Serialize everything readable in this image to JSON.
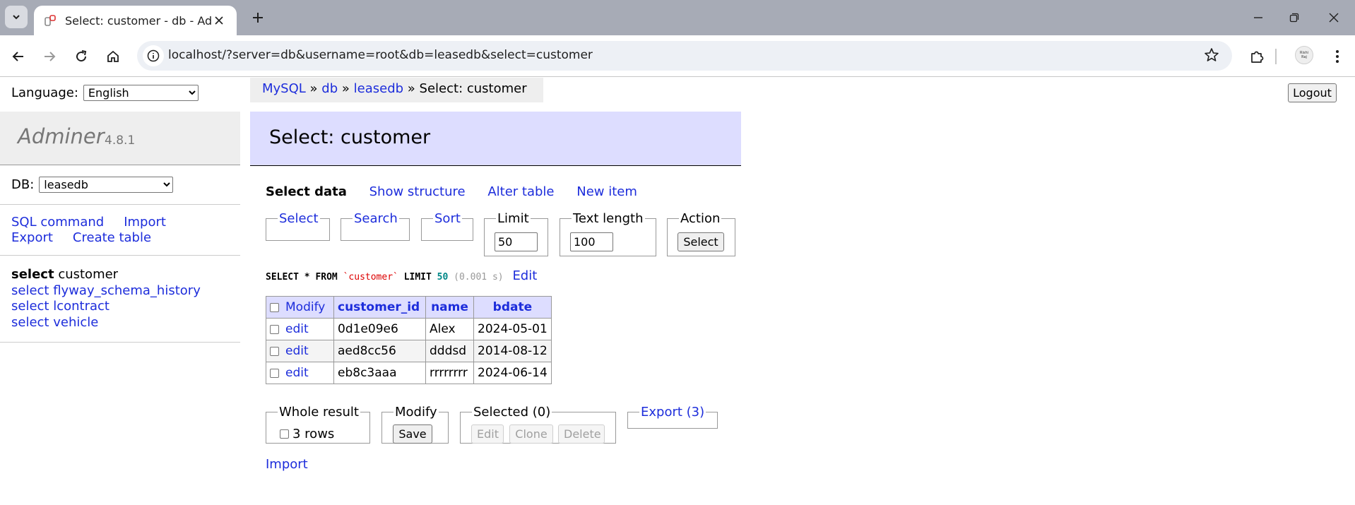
{
  "browser": {
    "tab_title": "Select: customer - db - Adminer",
    "url": "localhost/?server=db&username=root&db=leasedb&select=customer",
    "profile_initials": [
      "Rishi",
      "Raj"
    ]
  },
  "sidebar": {
    "language_label": "Language:",
    "language_value": "English",
    "app_name": "Adminer",
    "app_version": "4.8.1",
    "db_label": "DB:",
    "db_value": "leasedb",
    "links": [
      "SQL command",
      "Import",
      "Export",
      "Create table"
    ],
    "tables": [
      {
        "prefix": "select",
        "name": "customer",
        "active": true
      },
      {
        "prefix": "select",
        "name": "flyway_schema_history",
        "active": false
      },
      {
        "prefix": "select",
        "name": "lcontract",
        "active": false
      },
      {
        "prefix": "select",
        "name": "vehicle",
        "active": false
      }
    ]
  },
  "breadcrumb": {
    "items": [
      "MySQL",
      "db",
      "leasedb"
    ],
    "separator": "»",
    "current": "Select: customer"
  },
  "logout_label": "Logout",
  "heading": "Select: customer",
  "subnav": {
    "current": "Select data",
    "links": [
      "Show structure",
      "Alter table",
      "New item"
    ]
  },
  "form": {
    "select_legend": "Select",
    "search_legend": "Search",
    "sort_legend": "Sort",
    "limit_legend": "Limit",
    "limit_value": "50",
    "text_length_legend": "Text length",
    "text_length_value": "100",
    "action_legend": "Action",
    "action_button": "Select"
  },
  "query": {
    "keyword1": "SELECT",
    "star": "*",
    "keyword2": "FROM",
    "table": "`customer`",
    "keyword3": "LIMIT",
    "limit": "50",
    "time": "(0.001 s)",
    "edit_link": "Edit"
  },
  "table": {
    "columns": [
      "Modify",
      "customer_id",
      "name",
      "bdate"
    ],
    "rows": [
      {
        "edit": "edit",
        "customer_id": "0d1e09e6",
        "name": "Alex",
        "bdate": "2024-05-01"
      },
      {
        "edit": "edit",
        "customer_id": "aed8cc56",
        "name": "dddsd",
        "bdate": "2014-08-12"
      },
      {
        "edit": "edit",
        "customer_id": "eb8c3aaa",
        "name": "rrrrrrrr",
        "bdate": "2024-06-14"
      }
    ]
  },
  "bottom": {
    "whole_result_legend": "Whole result",
    "rows_label": "3 rows",
    "modify_legend": "Modify",
    "save_button": "Save",
    "selected_legend": "Selected (0)",
    "edit_button": "Edit",
    "clone_button": "Clone",
    "delete_button": "Delete",
    "export_legend": "Export (3)",
    "import_link": "Import"
  }
}
